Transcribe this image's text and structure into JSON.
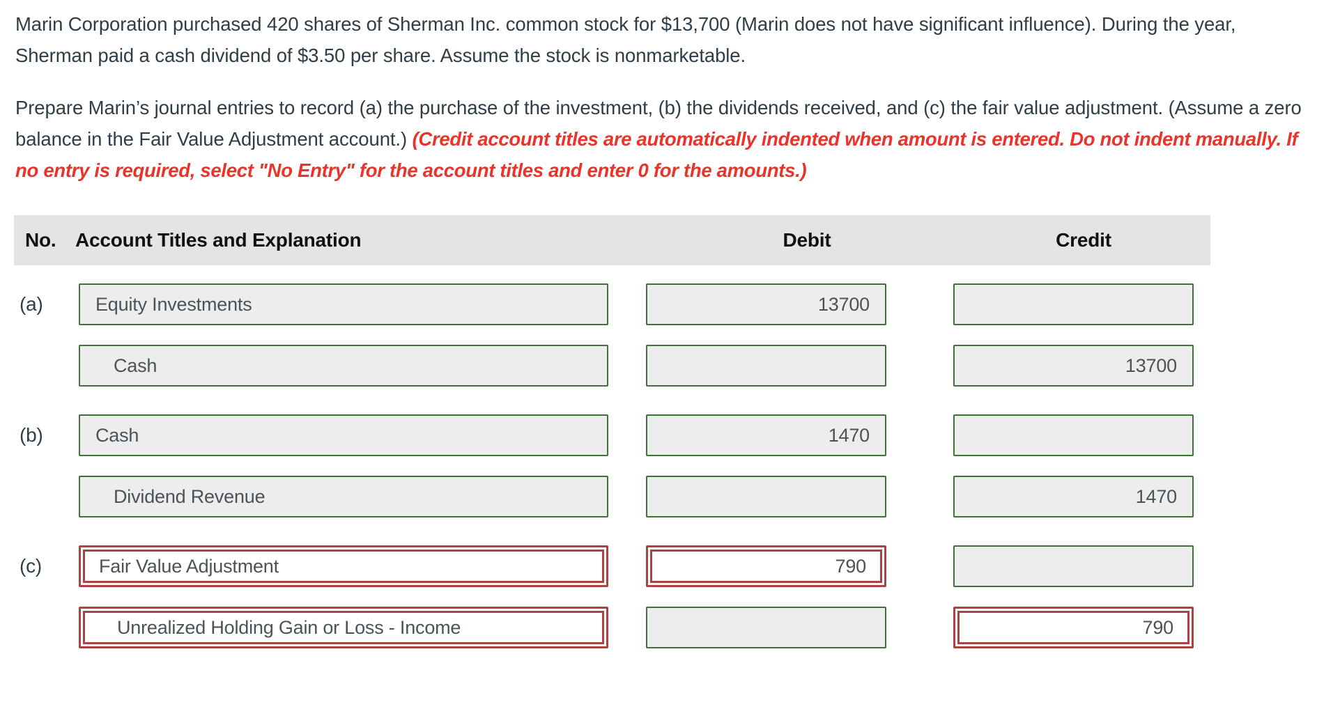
{
  "problem": {
    "paragraph1": "Marin Corporation purchased 420 shares of Sherman Inc. common stock for $13,700 (Marin does not have significant influence). During the year, Sherman paid a cash dividend of $3.50 per share. Assume the stock is nonmarketable.",
    "paragraph2_main": "Prepare Marin’s journal entries to record (a) the purchase of the investment, (b) the dividends received, and (c) the fair value adjustment. (Assume a zero balance in the Fair Value Adjustment account.) ",
    "paragraph2_hint": "(Credit account titles are automatically indented when amount is entered. Do not indent manually. If no entry is required, select \"No Entry\" for the account titles and enter 0 for the amounts.)"
  },
  "table": {
    "headers": {
      "no": "No.",
      "account": "Account Titles and Explanation",
      "debit": "Debit",
      "credit": "Credit"
    },
    "rows": [
      {
        "no": "(a)",
        "account": "Equity Investments",
        "indent": false,
        "debit": "13700",
        "credit": "",
        "state": "valid"
      },
      {
        "no": "",
        "account": "Cash",
        "indent": true,
        "debit": "",
        "credit": "13700",
        "state": "valid"
      },
      {
        "no": "(b)",
        "account": "Cash",
        "indent": false,
        "debit": "1470",
        "credit": "",
        "state": "valid"
      },
      {
        "no": "",
        "account": "Dividend Revenue",
        "indent": true,
        "debit": "",
        "credit": "1470",
        "state": "valid"
      },
      {
        "no": "(c)",
        "account": "Fair Value Adjustment",
        "indent": false,
        "debit": "790",
        "credit": "",
        "state": "error"
      },
      {
        "no": "",
        "account": "Unrealized Holding Gain or Loss - Income",
        "indent": true,
        "debit": "",
        "credit": "790",
        "state": "error"
      }
    ]
  },
  "colors": {
    "header_background": "#e4e4e4",
    "input_background": "#ededed",
    "valid_border": "#3f7239",
    "error_border": "#a94442",
    "hint_text": "#e8342a",
    "body_text": "#2e3d47"
  }
}
